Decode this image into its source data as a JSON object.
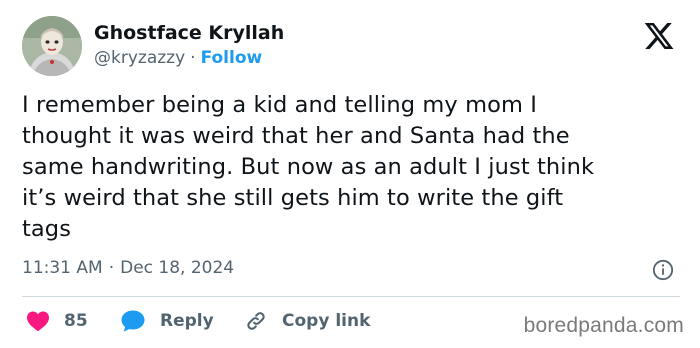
{
  "author": {
    "name": "Ghostface Kryllah",
    "handle": "@kryzazzy",
    "separator": "·",
    "follow_label": "Follow"
  },
  "tweet": {
    "lines": [
      "I remember being a kid and telling my mom I",
      "thought it was weird that her and Santa had the",
      "same handwriting. But now as an adult I just think",
      "it’s weird that she still gets him to write the gift",
      "tags"
    ],
    "time": "11:31 AM",
    "separator": "·",
    "date": "Dec 18, 2024"
  },
  "actions": {
    "likes_count": "85",
    "reply_label": "Reply",
    "copy_link_label": "Copy link"
  },
  "watermark": "boredpanda.com",
  "icons": {
    "logo": "x-logo-icon",
    "info": "info-icon",
    "like": "heart-icon",
    "reply": "speech-bubble-icon",
    "copy": "link-icon"
  },
  "colors": {
    "accent": "#1d9bf0",
    "like": "#f91880",
    "text": "#0f1419",
    "muted": "#536471"
  }
}
